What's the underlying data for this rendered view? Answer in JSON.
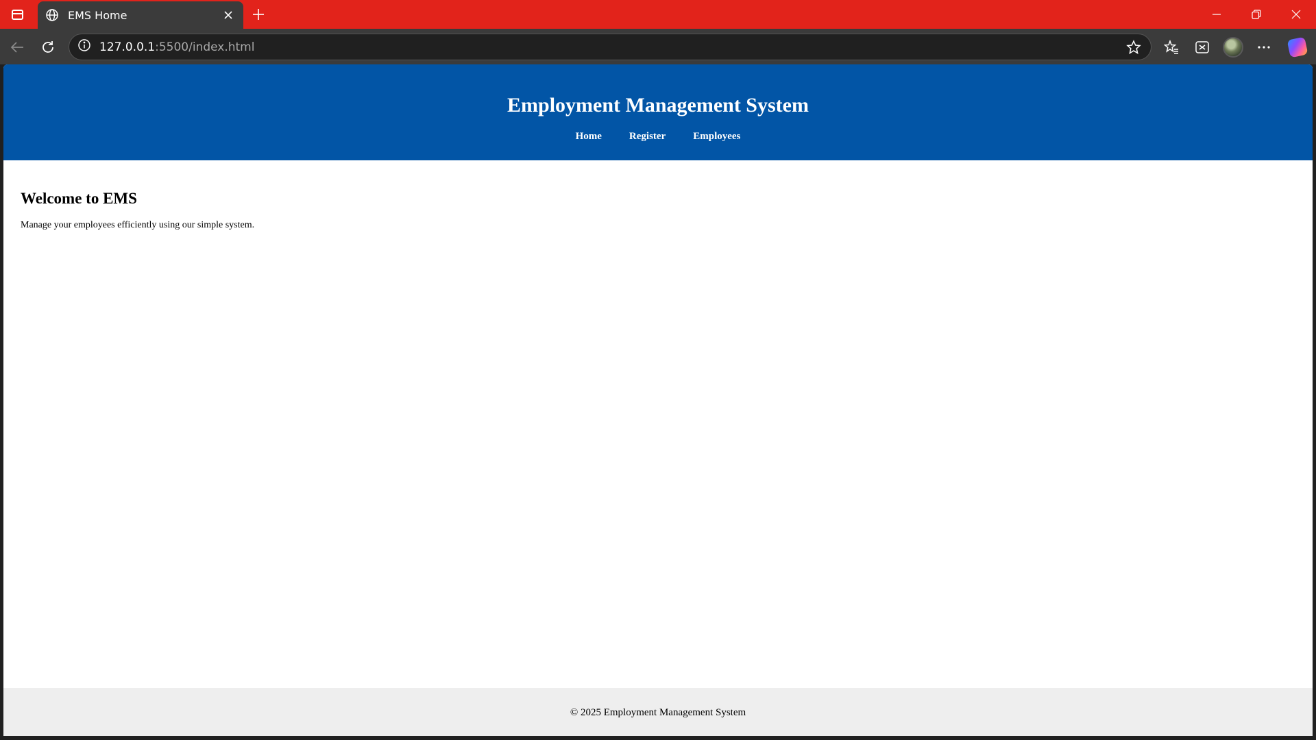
{
  "browser": {
    "tab_title": "EMS Home",
    "url_host": "127.0.0.1",
    "url_path": ":5500/index.html",
    "theme_color": "#e2231b"
  },
  "icons": {
    "tab_sidebar": "sidebar-icon",
    "favicon": "globe-icon",
    "tab_close": "close-icon",
    "new_tab": "plus-icon",
    "back": "back-arrow-icon",
    "refresh": "refresh-icon",
    "site_info": "info-icon",
    "favorite": "star-icon",
    "favorites_list": "favorites-icon",
    "extensions": "extension-icon",
    "profile": "avatar",
    "more": "more-icon",
    "copilot": "copilot-icon"
  },
  "site": {
    "title": "Employment Management System",
    "nav": [
      "Home",
      "Register",
      "Employees"
    ],
    "header_color": "#0255a6",
    "main": {
      "heading": "Welcome to EMS",
      "text": "Manage your employees efficiently using our simple system."
    },
    "footer": "© 2025 Employment Management System"
  }
}
